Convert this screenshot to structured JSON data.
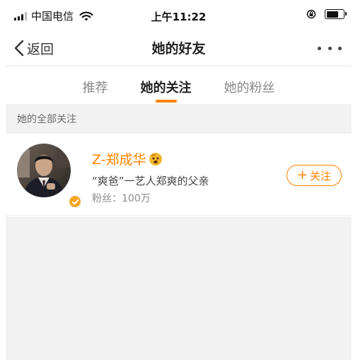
{
  "status_bar": {
    "carrier": "中国电信",
    "time": "上午11:22",
    "icons": [
      "signal-icon",
      "wifi-icon",
      "orientation-lock-icon",
      "battery-icon"
    ]
  },
  "nav": {
    "back_label": "返回",
    "title": "她的好友",
    "more_icon": "more-dots-icon"
  },
  "tabs": [
    {
      "label": "推荐",
      "active": false
    },
    {
      "label": "她的关注",
      "active": true
    },
    {
      "label": "她的粉丝",
      "active": false
    }
  ],
  "section": {
    "header": "她的全部关注"
  },
  "users": [
    {
      "name": "Z-郑成华",
      "description": "“爽爸”一艺人郑爽的父亲",
      "fans": "粉丝：100万",
      "verified": true,
      "follow_label": "关注"
    }
  ],
  "colors": {
    "accent": "#ff8200",
    "section_bg": "#f2f2f2",
    "badge": "#f5a623"
  }
}
